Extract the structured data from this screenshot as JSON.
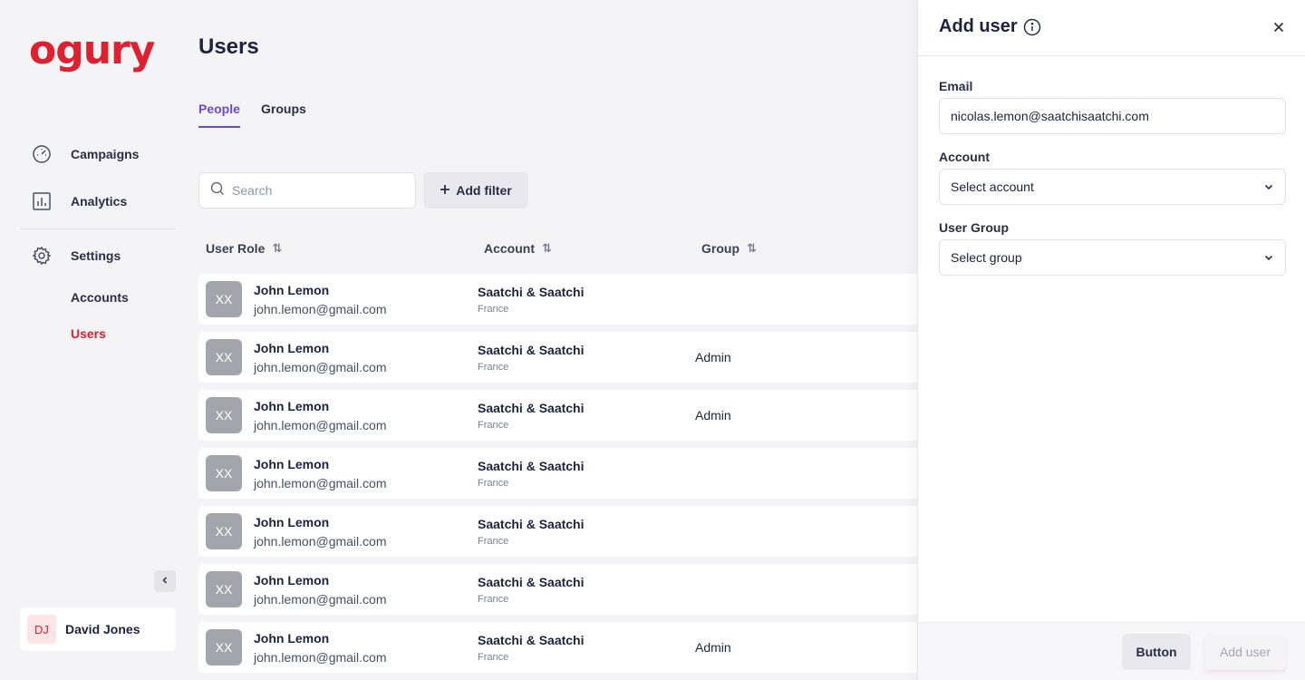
{
  "brand": {
    "logo_text": "ogury",
    "color": "#e0202e"
  },
  "sidebar": {
    "nav": [
      {
        "label": "Campaigns",
        "icon": "gauge-icon"
      },
      {
        "label": "Analytics",
        "icon": "bar-chart-icon"
      },
      {
        "label": "Settings",
        "icon": "gear-icon"
      }
    ],
    "sub_items": [
      {
        "label": "Accounts",
        "active": false
      },
      {
        "label": "Users",
        "active": true
      }
    ],
    "user": {
      "initials": "DJ",
      "name": "David Jones"
    }
  },
  "main": {
    "title": "Users",
    "tabs": [
      {
        "label": "People",
        "active": true
      },
      {
        "label": "Groups",
        "active": false
      }
    ],
    "search": {
      "placeholder": "Search",
      "value": ""
    },
    "add_filter_label": "Add filter",
    "columns": [
      "User Role",
      "Account",
      "Group"
    ],
    "rows": [
      {
        "initials": "XX",
        "name": "John Lemon",
        "email": "john.lemon@gmail.com",
        "account": "Saatchi & Saatchi",
        "country": "France",
        "group": ""
      },
      {
        "initials": "XX",
        "name": "John Lemon",
        "email": "john.lemon@gmail.com",
        "account": "Saatchi & Saatchi",
        "country": "France",
        "group": "Admin"
      },
      {
        "initials": "XX",
        "name": "John Lemon",
        "email": "john.lemon@gmail.com",
        "account": "Saatchi & Saatchi",
        "country": "France",
        "group": "Admin"
      },
      {
        "initials": "XX",
        "name": "John Lemon",
        "email": "john.lemon@gmail.com",
        "account": "Saatchi & Saatchi",
        "country": "France",
        "group": ""
      },
      {
        "initials": "XX",
        "name": "John Lemon",
        "email": "john.lemon@gmail.com",
        "account": "Saatchi & Saatchi",
        "country": "France",
        "group": ""
      },
      {
        "initials": "XX",
        "name": "John Lemon",
        "email": "john.lemon@gmail.com",
        "account": "Saatchi & Saatchi",
        "country": "France",
        "group": ""
      },
      {
        "initials": "XX",
        "name": "John Lemon",
        "email": "john.lemon@gmail.com",
        "account": "Saatchi & Saatchi",
        "country": "France",
        "group": "Admin"
      }
    ]
  },
  "drawer": {
    "title": "Add user",
    "email": {
      "label": "Email",
      "value": "nicolas.lemon@saatchisaatchi.com"
    },
    "account": {
      "label": "Account",
      "value": "Select account"
    },
    "group": {
      "label": "User Group",
      "value": "Select group"
    },
    "secondary_button": "Button",
    "primary_button": "Add user"
  },
  "colors": {
    "accent": "#6a48e0",
    "brand": "#e0202e",
    "text": "#1e2240"
  }
}
